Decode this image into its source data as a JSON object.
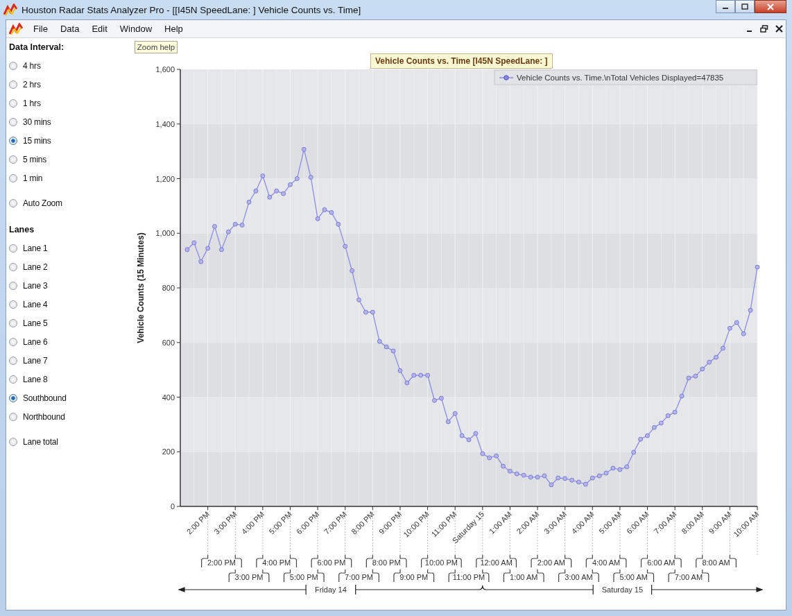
{
  "window": {
    "title": "Houston Radar Stats Analyzer Pro - [[I45N SpeedLane:  ] Vehicle Counts vs. Time]"
  },
  "menu": [
    "File",
    "Data",
    "Edit",
    "Window",
    "Help"
  ],
  "tooltip": "Zoom help",
  "data_interval": {
    "heading": "Data Interval:",
    "options": [
      {
        "label": "4 hrs",
        "selected": false
      },
      {
        "label": "2 hrs",
        "selected": false
      },
      {
        "label": "1 hrs",
        "selected": false
      },
      {
        "label": "30 mins",
        "selected": false
      },
      {
        "label": "15 mins",
        "selected": true
      },
      {
        "label": "5 mins",
        "selected": false
      },
      {
        "label": "1 min",
        "selected": false
      },
      {
        "label": "Auto Zoom",
        "selected": false
      }
    ]
  },
  "lanes": {
    "heading": "Lanes",
    "options": [
      {
        "label": "Lane 1",
        "selected": false
      },
      {
        "label": "Lane 2",
        "selected": false
      },
      {
        "label": "Lane 3",
        "selected": false
      },
      {
        "label": "Lane 4",
        "selected": false
      },
      {
        "label": "Lane 5",
        "selected": false
      },
      {
        "label": "Lane 6",
        "selected": false
      },
      {
        "label": "Lane 7",
        "selected": false
      },
      {
        "label": "Lane 8",
        "selected": false
      },
      {
        "label": "Southbound",
        "selected": true
      },
      {
        "label": "Northbound",
        "selected": false
      },
      {
        "label": "Lane total",
        "selected": false
      }
    ]
  },
  "chart": {
    "chart_data": {
      "type": "line",
      "title": "Vehicle Counts vs. Time [I45N SpeedLane: ]",
      "ylabel": "Vehicle Counts (15 Minutes)",
      "grid": true,
      "x": [
        13.25,
        13.5,
        13.75,
        14,
        14.25,
        14.5,
        14.75,
        15,
        15.25,
        15.5,
        15.75,
        16,
        16.25,
        16.5,
        16.75,
        17,
        17.25,
        17.5,
        17.75,
        18,
        18.25,
        18.5,
        18.75,
        19,
        19.25,
        19.5,
        19.75,
        20,
        20.25,
        20.5,
        20.75,
        21,
        21.25,
        21.5,
        21.75,
        22,
        22.25,
        22.5,
        22.75,
        23,
        23.25,
        23.5,
        23.75,
        24,
        24.25,
        24.5,
        24.75,
        25,
        25.25,
        25.5,
        25.75,
        26,
        26.25,
        26.5,
        26.75,
        27,
        27.25,
        27.5,
        27.75,
        28,
        28.25,
        28.5,
        28.75,
        29,
        29.25,
        29.5,
        29.75,
        30,
        30.25,
        30.5,
        30.75,
        31,
        31.25,
        31.5,
        31.75,
        32,
        32.25,
        32.5,
        32.75,
        33,
        33.25,
        33.5,
        33.75,
        34
      ],
      "series": [
        {
          "name": "Vehicle Counts vs. Time.\\nTotal Vehicles Displayed=47835",
          "color": "#8c8ce6",
          "marker": "circle",
          "values": [
            940,
            965,
            896,
            945,
            1025,
            940,
            1005,
            1033,
            1030,
            1114,
            1155,
            1210,
            1132,
            1155,
            1145,
            1178,
            1200,
            1307,
            1205,
            1053,
            1086,
            1076,
            1033,
            952,
            863,
            756,
            711,
            711,
            604,
            584,
            569,
            497,
            452,
            480,
            480,
            480,
            388,
            396,
            310,
            340,
            259,
            244,
            267,
            193,
            178,
            185,
            147,
            129,
            119,
            114,
            107,
            107,
            112,
            79,
            104,
            102,
            96,
            89,
            81,
            104,
            112,
            122,
            140,
            135,
            145,
            198,
            246,
            259,
            289,
            305,
            332,
            345,
            404,
            470,
            477,
            503,
            528,
            546,
            579,
            652,
            673,
            632,
            718,
            876
          ]
        }
      ],
      "xlim": [
        13,
        34
      ],
      "ylim": [
        0,
        1600
      ],
      "xticks": [
        {
          "value": 14,
          "label": "2:00 PM"
        },
        {
          "value": 15,
          "label": "3:00 PM"
        },
        {
          "value": 16,
          "label": "4:00 PM"
        },
        {
          "value": 17,
          "label": "5:00 PM"
        },
        {
          "value": 18,
          "label": "6:00 PM"
        },
        {
          "value": 19,
          "label": "7:00 PM"
        },
        {
          "value": 20,
          "label": "8:00 PM"
        },
        {
          "value": 21,
          "label": "9:00 PM"
        },
        {
          "value": 22,
          "label": "10:00 PM"
        },
        {
          "value": 23,
          "label": "11:00 PM"
        }
      ],
      "yticks": [
        {
          "value": 0,
          "label": "0"
        },
        {
          "value": 200,
          "label": "200"
        },
        {
          "value": 400,
          "label": "400"
        },
        {
          "value": 600,
          "label": "600"
        },
        {
          "value": 800,
          "label": "800"
        },
        {
          "value": 1000,
          "label": "1,000"
        },
        {
          "value": 1200,
          "label": "1,200"
        },
        {
          "value": 1400,
          "label": "1,400"
        },
        {
          "value": 1600,
          "label": "1,600"
        }
      ]
    },
    "next_day_hour_labels": [
      "Saturday 15",
      "1:00 AM",
      "2:00 AM",
      "3:00 AM",
      "4:00 AM",
      "5:00 AM",
      "6:00 AM",
      "7:00 AM",
      "8:00 AM",
      "9:00 AM",
      "10:00 AM"
    ],
    "time_ruler": {
      "upper": [
        "2:00 PM",
        "4:00 PM",
        "6:00 PM",
        "8:00 PM",
        "10:00 PM",
        "12:00 AM",
        "2:00 AM",
        "4:00 AM",
        "6:00 AM",
        "8:00 AM"
      ],
      "lower": [
        "3:00 PM",
        "5:00 PM",
        "7:00 PM",
        "9:00 PM",
        "11:00 PM",
        "1:00 AM",
        "3:00 AM",
        "5:00 AM",
        "7:00 AM"
      ],
      "days": [
        "Friday 14",
        "Saturday 15"
      ]
    }
  }
}
